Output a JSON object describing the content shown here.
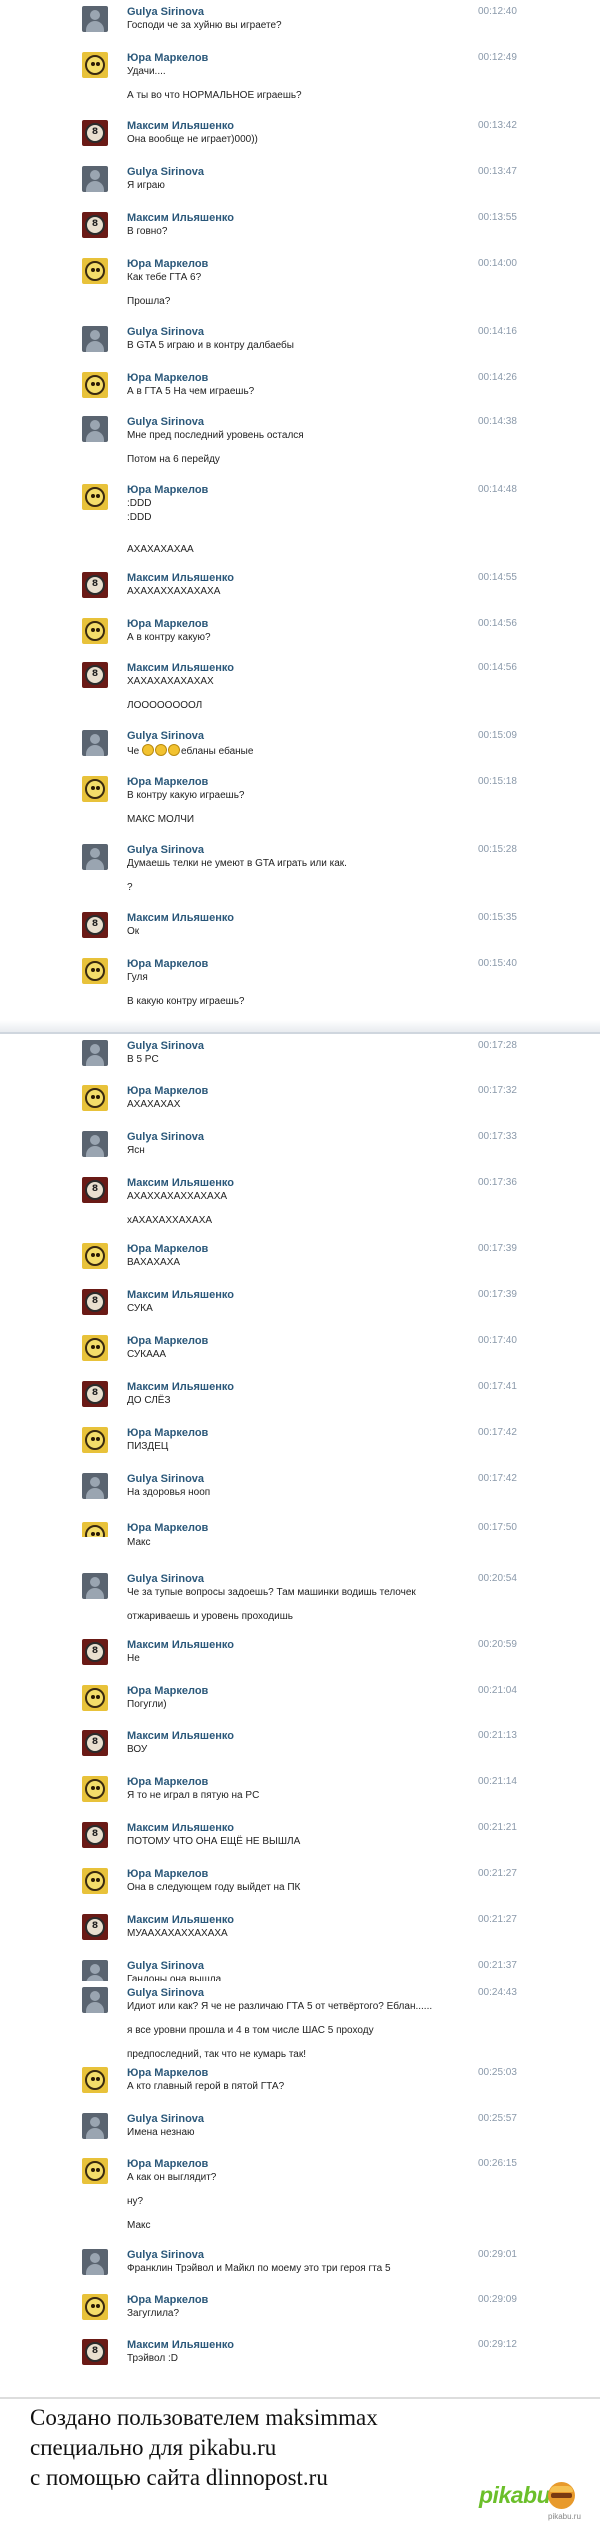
{
  "sections": [
    {
      "messages": [
        {
          "author": "Gulya Sirinova",
          "time": "00:12:40",
          "lines": [
            "Господи че за хуйню вы играете?"
          ]
        },
        {
          "author": "Юра Маркелов",
          "time": "00:12:49",
          "lines": [
            "Удачи....",
            "А ты во что НОРМАЛЬНОЕ играешь?"
          ]
        },
        {
          "author": "Максим Ильяшенко",
          "time": "00:13:42",
          "lines": [
            "Она вообще не играет)000))"
          ]
        },
        {
          "author": "Gulya Sirinova",
          "time": "00:13:47",
          "lines": [
            "Я играю"
          ]
        },
        {
          "author": "Максим Ильяшенко",
          "time": "00:13:55",
          "lines": [
            "В говно?"
          ]
        },
        {
          "author": "Юра Маркелов",
          "time": "00:14:00",
          "lines": [
            "Как тебе ГТА 6?",
            "Прошла?"
          ]
        },
        {
          "author": "Gulya Sirinova",
          "time": "00:14:16",
          "lines": [
            "В GTA 5 играю и в контру далбаебы"
          ]
        },
        {
          "author": "Юра Маркелов",
          "time": "00:14:26",
          "lines": [
            "А в ГТА 5 На чем играешь?"
          ]
        },
        {
          "author": "Gulya Sirinova",
          "time": "00:14:38",
          "lines": [
            "Мне пред последний уровень остался",
            "Потом на 6 перейду"
          ]
        },
        {
          "author": "Юра Маркелов",
          "time": "00:14:48",
          "lines": [
            ":DDD"
          ]
        }
      ]
    },
    {
      "messages": [
        {
          "author": "",
          "time": "",
          "lines": [
            ":DDD",
            "АХАХАХАХАА"
          ]
        },
        {
          "author": "Максим Ильяшенко",
          "time": "00:14:55",
          "lines": [
            "АХАХАХХАХАХАХА"
          ]
        },
        {
          "author": "Юра Маркелов",
          "time": "00:14:56",
          "lines": [
            "А в контру какую?"
          ]
        },
        {
          "author": "Максим Ильяшенко",
          "time": "00:14:56",
          "lines": [
            "ХАХАХАХАХАХАХ",
            "ЛООООООООЛ"
          ]
        },
        {
          "author": "Gulya Sirinova",
          "time": "00:15:09",
          "lines": [
            "Че @@@ебланы ебаные"
          ]
        },
        {
          "author": "Юра Маркелов",
          "time": "00:15:18",
          "lines": [
            "В контру какую играешь?",
            "МАКС МОЛЧИ"
          ]
        },
        {
          "author": "Gulya Sirinova",
          "time": "00:15:28",
          "lines": [
            "Думаешь телки не умеют в GTA играть или как.",
            "?"
          ]
        },
        {
          "author": "Максим Ильяшенко",
          "time": "00:15:35",
          "lines": [
            "Ок"
          ]
        },
        {
          "author": "Юра Маркелов",
          "time": "00:15:40",
          "lines": [
            "Гуля",
            "В какую контру играешь?"
          ]
        }
      ]
    },
    {
      "messages": [
        {
          "author": "Gulya Sirinova",
          "time": "00:17:28",
          "lines": [
            "В 5 PC"
          ]
        },
        {
          "author": "Юра Маркелов",
          "time": "00:17:32",
          "lines": [
            "АХАХАХАХ"
          ]
        },
        {
          "author": "Gulya Sirinova",
          "time": "00:17:33",
          "lines": [
            "Ясн"
          ]
        },
        {
          "author": "Максим Ильяшенко",
          "time": "00:17:36",
          "lines": [
            "АХАХХАХАХХАХАХА",
            "хАХАХАХХАХАХА"
          ]
        },
        {
          "author": "Юра Маркелов",
          "time": "00:17:39",
          "lines": [
            "ВАХАХАХА"
          ]
        },
        {
          "author": "Максим Ильяшенко",
          "time": "00:17:39",
          "lines": [
            "СУКА"
          ]
        },
        {
          "author": "Юра Маркелов",
          "time": "00:17:40",
          "lines": [
            "СУКААА"
          ]
        },
        {
          "author": "Максим Ильяшенко",
          "time": "00:17:41",
          "lines": [
            "ДО СЛЁЗ"
          ]
        },
        {
          "author": "Юра Маркелов",
          "time": "00:17:42",
          "lines": [
            "ПИЗДЕЦ"
          ]
        },
        {
          "author": "Gulya Sirinova",
          "time": "00:17:42",
          "lines": [
            "На здоровья нооп"
          ]
        },
        {
          "author": "Юра Маркелов",
          "time": "00:17:50",
          "lines": []
        }
      ]
    },
    {
      "messages": [
        {
          "author": "",
          "time": "",
          "lines": [
            "Макс"
          ]
        },
        {
          "author": "Gulya Sirinova",
          "time": "00:20:54",
          "lines": [
            "Че за тупые вопросы задоешь? Там машинки водишь телочек",
            "отжариваешь и уровень проходишь"
          ]
        },
        {
          "author": "Максим Ильяшенко",
          "time": "00:20:59",
          "lines": [
            "Не"
          ]
        },
        {
          "author": "Юра Маркелов",
          "time": "00:21:04",
          "lines": [
            "Погугли)"
          ]
        },
        {
          "author": "Максим Ильяшенко",
          "time": "00:21:13",
          "lines": [
            "ВОУ"
          ]
        },
        {
          "author": "Юра Маркелов",
          "time": "00:21:14",
          "lines": [
            "Я то не играл в пятую на PC"
          ]
        },
        {
          "author": "Максим Ильяшенко",
          "time": "00:21:21",
          "lines": [
            "ПОТОМУ ЧТО ОНА ЕЩЁ НЕ ВЫШЛА"
          ]
        },
        {
          "author": "Юра Маркелов",
          "time": "00:21:27",
          "lines": [
            "Она в следующем году выйдет на ПК"
          ]
        },
        {
          "author": "Максим Ильяшенко",
          "time": "00:21:27",
          "lines": [
            "МУААХАХАХХАХАХА"
          ]
        },
        {
          "author": "Gulya Sirinova",
          "time": "00:21:37",
          "lines": [
            "Гандоны она вышла"
          ]
        }
      ]
    },
    {
      "messages": [
        {
          "author": "Gulya Sirinova",
          "time": "00:24:43",
          "lines": [
            "Идиот или как? Я че не различаю ГТА 5 от четвёртого? Еблан......",
            "я все уровни прошла и 4 в том числе ШАС 5 проходу",
            "предпоследний, так что не кумарь так!"
          ]
        },
        {
          "author": "Юра Маркелов",
          "time": "00:25:03",
          "lines": [
            "А кто главный герой в пятой ГТА?"
          ]
        },
        {
          "author": "Gulya Sirinova",
          "time": "00:25:57",
          "lines": [
            "Имена незнаю"
          ]
        },
        {
          "author": "Юра Маркелов",
          "time": "00:26:15",
          "lines": [
            "А как он выглядит?",
            "ну?",
            "Макс"
          ]
        },
        {
          "author": "Gulya Sirinova",
          "time": "00:29:01",
          "lines": [
            "Франклин Трэйвол и Майкл по моему это три героя гта 5"
          ]
        },
        {
          "author": "Юра Маркелов",
          "time": "00:29:09",
          "lines": [
            "Загуглила?"
          ]
        },
        {
          "author": "Максим Ильяшенко",
          "time": "00:29:12",
          "lines": [
            "Трэйвол :D"
          ]
        }
      ]
    }
  ],
  "footer": {
    "line1": "Создано пользователем maksimmax",
    "line2": "специально для pikabu.ru",
    "line3": "с помощью сайта dlinnopost.ru",
    "logo": "pikabu",
    "credit": "pikabu.ru"
  }
}
